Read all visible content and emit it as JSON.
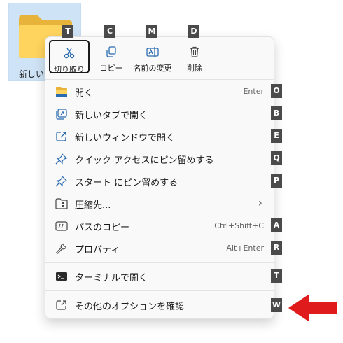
{
  "folder": {
    "label": "新しいフ",
    "icon": "folder-icon"
  },
  "quick_actions": [
    {
      "label": "切り取り",
      "icon": "cut-icon",
      "key": "T"
    },
    {
      "label": "コピー",
      "icon": "copy-icon",
      "key": "C"
    },
    {
      "label": "名前の変更",
      "icon": "rename-icon",
      "key": "M"
    },
    {
      "label": "削除",
      "icon": "delete-icon",
      "key": "D"
    }
  ],
  "items": [
    {
      "label": "開く",
      "shortcut": "Enter",
      "key": "O",
      "icon": "folder-open-icon"
    },
    {
      "label": "新しいタブで開く",
      "shortcut": "",
      "key": "B",
      "icon": "new-tab-icon"
    },
    {
      "label": "新しいウィンドウで開く",
      "shortcut": "",
      "key": "E",
      "icon": "new-window-icon"
    },
    {
      "label": "クイック アクセスにピン留めする",
      "shortcut": "",
      "key": "Q",
      "icon": "pin-icon"
    },
    {
      "label": "スタート にピン留めする",
      "shortcut": "",
      "key": "P",
      "icon": "pin-icon"
    },
    {
      "label": "圧縮先...",
      "shortcut": "",
      "key": "",
      "icon": "compress-icon",
      "submenu": "›"
    },
    {
      "label": "パスのコピー",
      "shortcut": "Ctrl+Shift+C",
      "key": "A",
      "icon": "copy-path-icon"
    },
    {
      "label": "プロパティ",
      "shortcut": "Alt+Enter",
      "key": "R",
      "icon": "wrench-icon"
    },
    {
      "label": "ターミナルで開く",
      "shortcut": "",
      "key": "T",
      "icon": "terminal-icon"
    },
    {
      "label": "その他のオプションを確認",
      "shortcut": "",
      "key": "W",
      "icon": "more-options-icon"
    }
  ],
  "colors": {
    "arrow": "#e01b1b",
    "key_badge": "#4a4a4a",
    "selection_tile": "#cfe3f6"
  }
}
